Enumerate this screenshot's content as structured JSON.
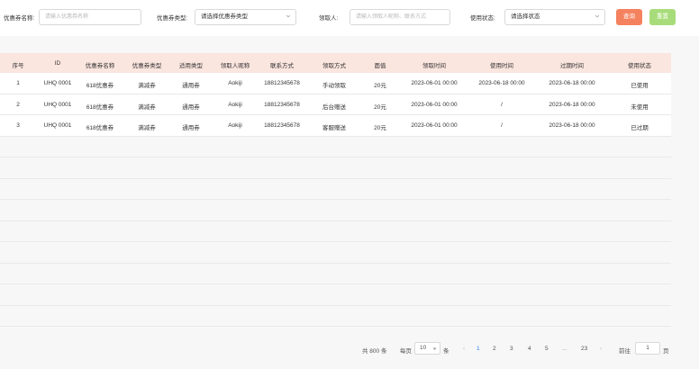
{
  "filters": {
    "coupon_name_label": "优惠券名称:",
    "coupon_name_placeholder": "请输入优惠券名称",
    "coupon_type_label": "优惠券类型:",
    "coupon_type_value": "请选择优惠券类型",
    "receiver_label": "领取人:",
    "receiver_placeholder": "请输入领取人昵称、联系方式",
    "use_status_label": "使用状态:",
    "use_status_value": "请选择状态",
    "search_button": "查询",
    "reset_button": "重置"
  },
  "table": {
    "columns": [
      "序号",
      "ID",
      "优惠券名称",
      "优惠券类型",
      "适用类型",
      "领取人昵称",
      "联系方式",
      "领取方式",
      "面值",
      "领取时间",
      "使用时间",
      "过期时间",
      "使用状态"
    ],
    "rows": [
      [
        "1",
        "UHQ 0001",
        "618优惠券",
        "满减券",
        "通用券",
        "Aokiji",
        "18812345678",
        "手动领取",
        "20元",
        "2023-06-01 00:00",
        "2023-06-18 00:00",
        "2023-06-18 00:00",
        "已使用"
      ],
      [
        "2",
        "UHQ 0001",
        "618优惠券",
        "满减券",
        "通用券",
        "Aokiji",
        "18812345678",
        "后台赠送",
        "20元",
        "2023-06-01 00:00",
        "/",
        "2023-06-18 00:00",
        "未使用"
      ],
      [
        "3",
        "UHQ 0001",
        "618优惠券",
        "满减券",
        "通用券",
        "Aokiji",
        "18812345678",
        "客服赠送",
        "20元",
        "2023-06-01 00:00",
        "/",
        "2023-06-18 00:00",
        "已过期"
      ]
    ]
  },
  "pagination": {
    "total": "共 800 条",
    "per_page_label": "每页",
    "per_page_value": "10",
    "per_page_unit": "条",
    "prev": "‹",
    "pages": [
      "1",
      "2",
      "3",
      "4",
      "5"
    ],
    "ellipsis": "...",
    "last_page": "23",
    "next": "›",
    "goto_label": "前往",
    "goto_value": "1",
    "goto_unit": "页",
    "current_page": "1"
  },
  "colors": {
    "accent_orange": "#f5825f",
    "accent_green": "#a8dc7a",
    "header_bg": "#fbe5df",
    "active_page": "#2f7ef5"
  },
  "icons": {
    "select_chevron": "chevron-down-icon"
  }
}
